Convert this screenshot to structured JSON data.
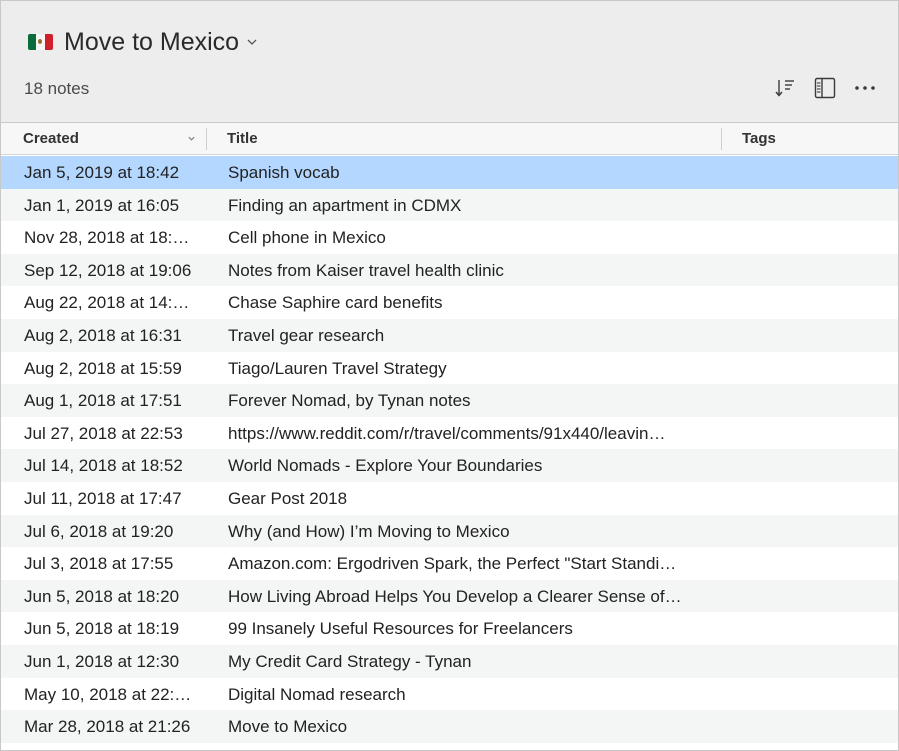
{
  "notebook": {
    "title": "Move to Mexico",
    "flag_icon": "mexico-flag-icon",
    "note_count": "18 notes"
  },
  "toolbar": {
    "icons": [
      "sort-icon",
      "view-layout-icon",
      "more-options-icon"
    ]
  },
  "columns": {
    "created": "Created",
    "title": "Title",
    "tags": "Tags"
  },
  "colors": {
    "selected_row": "#b3d7ff",
    "alt_row": "#f4f5f5",
    "header_bg": "#ededed"
  },
  "notes": [
    {
      "created": "Jan 5, 2019 at 18:42",
      "title": "Spanish vocab",
      "tags": "",
      "selected": true
    },
    {
      "created": "Jan 1, 2019 at 16:05",
      "title": "Finding an apartment in CDMX",
      "tags": ""
    },
    {
      "created": "Nov 28, 2018 at 18:…",
      "title": "Cell phone in Mexico",
      "tags": ""
    },
    {
      "created": "Sep 12, 2018 at 19:06",
      "title": "Notes from Kaiser travel health clinic",
      "tags": ""
    },
    {
      "created": "Aug 22, 2018 at 14:…",
      "title": "Chase Saphire card benefits",
      "tags": ""
    },
    {
      "created": "Aug 2, 2018 at 16:31",
      "title": "Travel gear research",
      "tags": ""
    },
    {
      "created": "Aug 2, 2018 at 15:59",
      "title": "Tiago/Lauren Travel Strategy",
      "tags": ""
    },
    {
      "created": "Aug 1, 2018 at 17:51",
      "title": "Forever Nomad, by Tynan notes",
      "tags": ""
    },
    {
      "created": "Jul 27, 2018 at 22:53",
      "title": "https://www.reddit.com/r/travel/comments/91x440/leavin…",
      "tags": ""
    },
    {
      "created": "Jul 14, 2018 at 18:52",
      "title": "World Nomads - Explore Your Boundaries",
      "tags": ""
    },
    {
      "created": "Jul 11, 2018 at 17:47",
      "title": "Gear Post 2018",
      "tags": ""
    },
    {
      "created": "Jul 6, 2018 at 19:20",
      "title": "Why (and How) I’m Moving to Mexico",
      "tags": ""
    },
    {
      "created": "Jul 3, 2018 at 17:55",
      "title": "Amazon.com: Ergodriven Spark, the Perfect \"Start Standi…",
      "tags": ""
    },
    {
      "created": "Jun 5, 2018 at 18:20",
      "title": "How Living Abroad Helps You Develop a Clearer Sense of…",
      "tags": ""
    },
    {
      "created": "Jun 5, 2018 at 18:19",
      "title": "99 Insanely Useful Resources for Freelancers",
      "tags": ""
    },
    {
      "created": "Jun 1, 2018 at 12:30",
      "title": "My Credit Card Strategy - Tynan",
      "tags": ""
    },
    {
      "created": "May 10, 2018 at 22:…",
      "title": "Digital Nomad research",
      "tags": ""
    },
    {
      "created": "Mar 28, 2018 at 21:26",
      "title": "Move to Mexico",
      "tags": ""
    }
  ]
}
